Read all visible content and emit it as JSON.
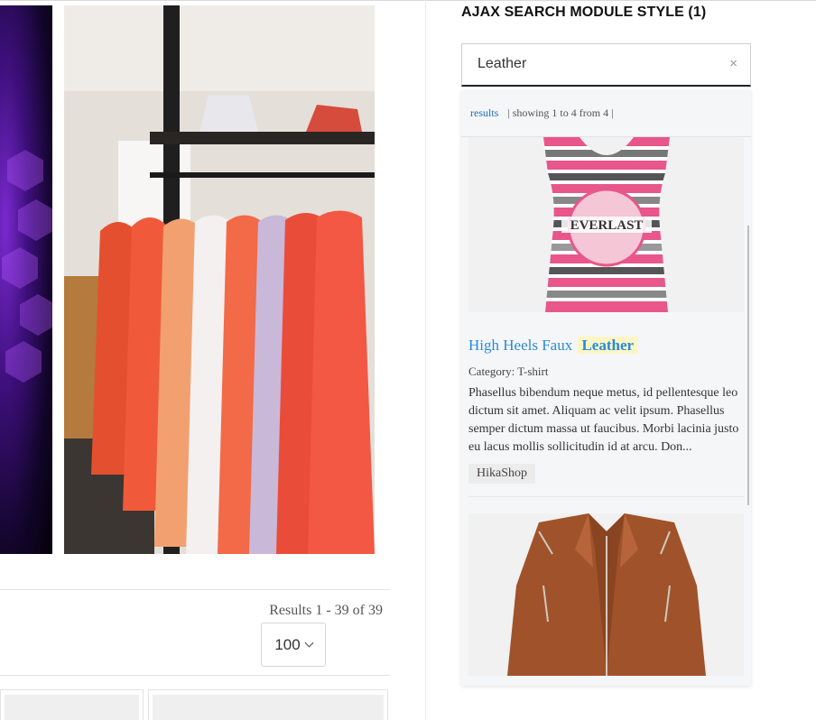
{
  "module": {
    "title": "AJAX SEARCH MODULE STYLE (1)",
    "search": {
      "value": "Leather",
      "clear_glyph": "×"
    }
  },
  "dropdown": {
    "tab_label": "results",
    "meta": "| showing 1 to 4 from 4 |",
    "items": [
      {
        "title": "High Heels Faux",
        "highlight": "Leather",
        "category": "Category: T-shirt",
        "description": "Phasellus bibendum neque metus, id pellentesque leo dictum sit amet. Aliquam ac velit ipsum. Phasellus semper dictum massa ut faucibus. Morbi lacinia justo eu lacus mollis sollicitudin id at arcu. Don...",
        "tag": "HikaShop",
        "image_icon": "striped-tshirt-image",
        "print_text": "EVERLAST"
      },
      {
        "image_icon": "leather-jacket-image"
      }
    ]
  },
  "listing": {
    "results_count": "Results 1 - 39 of 39",
    "limit_value": "100"
  },
  "colors": {
    "link": "#2a8ad8",
    "highlight_bg": "#fdf5c6",
    "tab_link": "#1a6fc0"
  }
}
